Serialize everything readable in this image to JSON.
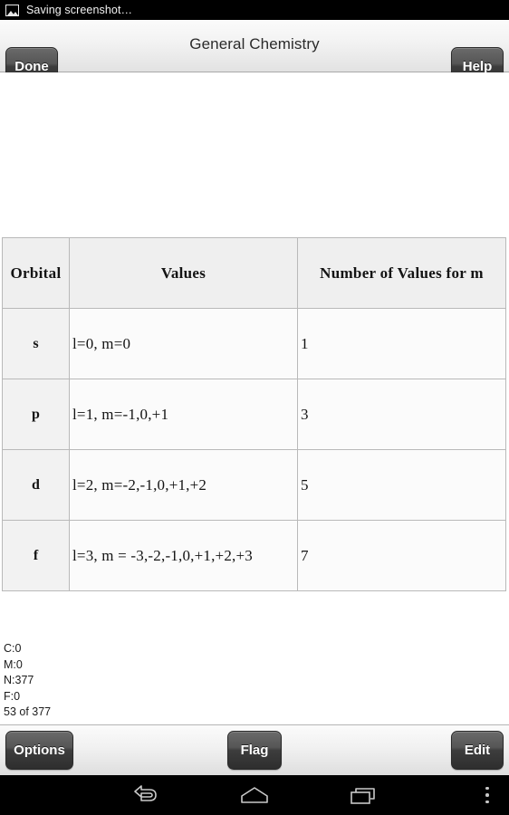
{
  "status_bar": {
    "icon": "image-icon",
    "text": "Saving screenshot…"
  },
  "top_bar": {
    "done_label": "Done",
    "title": "General Chemistry",
    "help_label": "Help"
  },
  "table": {
    "headers": [
      "Orbital",
      "Values",
      "Number of Values for m"
    ],
    "rows": [
      {
        "orbital": "s",
        "values": "l=0, m=0",
        "count": "1"
      },
      {
        "orbital": "p",
        "values": "l=1, m=-1,0,+1",
        "count": "3"
      },
      {
        "orbital": "d",
        "values": "l=2, m=-2,-1,0,+1,+2",
        "count": "5"
      },
      {
        "orbital": "f",
        "values": "l=3, m = -3,-2,-1,0,+1,+2,+3",
        "count": "7"
      }
    ]
  },
  "stats": {
    "correct": "C:0",
    "missed": "M:0",
    "new": "N:377",
    "flagged": "F:0",
    "position": "53 of 377"
  },
  "bottom_bar": {
    "options_label": "Options",
    "flag_label": "Flag",
    "edit_label": "Edit"
  },
  "nav_bar": {
    "back": "back-icon",
    "home": "home-icon",
    "recents": "recents-icon",
    "menu": "overflow-menu-icon"
  },
  "colors": {
    "status_bar_bg": "#000000",
    "toolbar_bg": "#f1f1f1",
    "button_dark": "#3d3d3d",
    "table_header_bg": "#efefef",
    "table_cell_bg": "#fbfbfb",
    "table_border": "#b9b9b9"
  }
}
